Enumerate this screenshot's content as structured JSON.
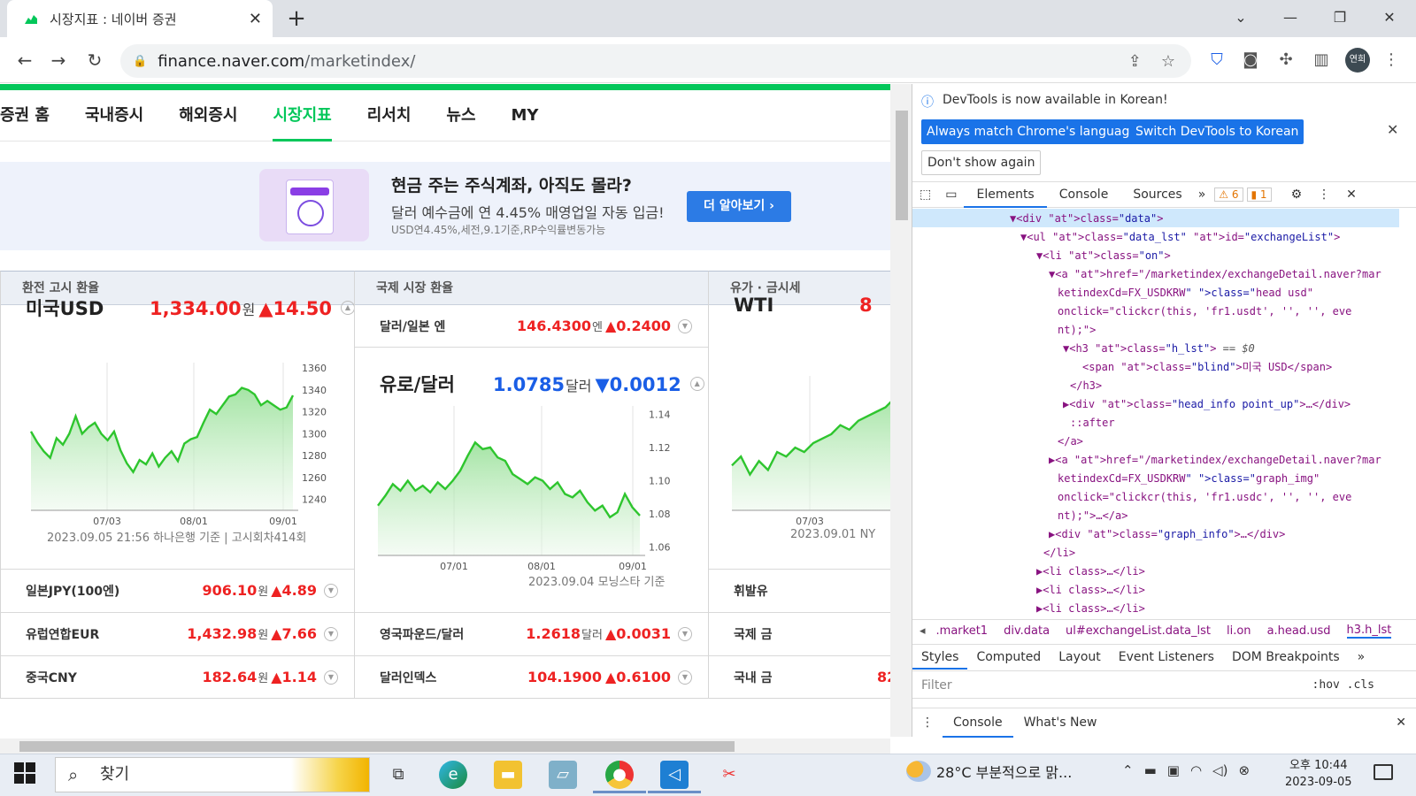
{
  "browser": {
    "tab_title": "시장지표 : 네이버 증권",
    "tab_close": "✕",
    "new_tab": "+",
    "url_host": "finance.naver.com",
    "url_path": "/marketindex/",
    "profile": "연희"
  },
  "naver": {
    "gnb": [
      {
        "label": "증권 홈",
        "on": false
      },
      {
        "label": "국내증시",
        "on": false
      },
      {
        "label": "해외증시",
        "on": false
      },
      {
        "label": "시장지표",
        "on": true
      },
      {
        "label": "리서치",
        "on": false
      },
      {
        "label": "뉴스",
        "on": false
      },
      {
        "label": "MY",
        "on": false
      }
    ],
    "banner": {
      "title": "현금 주는 주식계좌, 아직도 몰라?",
      "subtitle": "달러 예수금에 연 4.45% 매영업일 자동 입금!",
      "note": "USD연4.45%,세전,9.1기준,RP수익률변동가능",
      "button": "더 알아보기 ›"
    },
    "panels": {
      "exchange": {
        "heading": "환전 고시 환율",
        "main": {
          "name": "미국USD",
          "value": "1,334.00",
          "unit": "원",
          "change": "▲14.50"
        },
        "meta": "2023.09.05 21:56 하나은행 기준 | 고시회차414회",
        "rows": [
          {
            "name": "일본JPY(100엔)",
            "value": "906.10",
            "unit": "원",
            "change": "▲4.89"
          },
          {
            "name": "유럽연합EUR",
            "value": "1,432.98",
            "unit": "원",
            "change": "▲7.66"
          },
          {
            "name": "중국CNY",
            "value": "182.64",
            "unit": "원",
            "change": "▲1.14"
          }
        ]
      },
      "intl": {
        "heading": "국제 시장 환율",
        "top_row": {
          "name": "달러/일본 엔",
          "value": "146.4300",
          "unit": "엔",
          "change": "▲0.2400"
        },
        "main": {
          "name": "유로/달러",
          "value": "1.0785",
          "unit": "달러",
          "change": "▼0.0012"
        },
        "meta": "2023.09.04 모닝스타 기준",
        "rows": [
          {
            "name": "영국파운드/달러",
            "value": "1.2618",
            "unit": "달러",
            "change": "▲0.0031"
          },
          {
            "name": "달러인덱스",
            "value": "104.1900",
            "unit": "",
            "change": "▲0.6100"
          }
        ]
      },
      "oil": {
        "heading": "유가 · 금시세",
        "main": {
          "name": "WTI",
          "value": "8"
        },
        "meta": "2023.09.01 NY",
        "rows": [
          {
            "name": "휘발유",
            "value": ""
          },
          {
            "name": "국제 금",
            "value": ""
          },
          {
            "name": "국내 금",
            "value": "82"
          }
        ]
      }
    }
  },
  "chart_data": [
    {
      "type": "area",
      "x_ticks": [
        "07/03",
        "08/01",
        "09/01"
      ],
      "y_ticks": [
        1360,
        1340,
        1320,
        1300,
        1280,
        1260,
        1240
      ],
      "ylim": [
        1230,
        1365
      ],
      "values": [
        1302,
        1292,
        1284,
        1278,
        1296,
        1290,
        1300,
        1316,
        1300,
        1306,
        1310,
        1300,
        1294,
        1302,
        1285,
        1273,
        1265,
        1276,
        1272,
        1282,
        1270,
        1278,
        1284,
        1275,
        1291,
        1295,
        1297,
        1310,
        1322,
        1318,
        1326,
        1334,
        1336,
        1342,
        1340,
        1336,
        1326,
        1330,
        1326,
        1322,
        1324,
        1335
      ]
    },
    {
      "type": "area",
      "x_ticks": [
        "07/01",
        "08/01",
        "09/01"
      ],
      "y_ticks": [
        1.14,
        1.12,
        1.1,
        1.08,
        1.06
      ],
      "ylim": [
        1.055,
        1.145
      ],
      "values": [
        1.085,
        1.091,
        1.098,
        1.094,
        1.1,
        1.094,
        1.097,
        1.093,
        1.099,
        1.095,
        1.1,
        1.106,
        1.115,
        1.123,
        1.119,
        1.12,
        1.114,
        1.112,
        1.104,
        1.101,
        1.098,
        1.102,
        1.1,
        1.095,
        1.099,
        1.092,
        1.09,
        1.094,
        1.087,
        1.082,
        1.085,
        1.078,
        1.081,
        1.092,
        1.084,
        1.079
      ]
    },
    {
      "type": "area",
      "x_ticks": [
        "07/03"
      ],
      "y_ticks": [],
      "ylim": [
        60,
        90
      ],
      "values": [
        70,
        72,
        68,
        71,
        69,
        73,
        72,
        74,
        73,
        75,
        76,
        77,
        79,
        78,
        80,
        81,
        82,
        83,
        85,
        86
      ]
    }
  ],
  "devtools": {
    "info": "DevTools is now available in Korean!",
    "btn_match": "Always match Chrome's language",
    "btn_switch": "Switch DevTools to Korean",
    "btn_noshow": "Don't show again",
    "tabs": [
      "Elements",
      "Console",
      "Sources",
      "»"
    ],
    "warn_count": "6",
    "issue_count": "1",
    "crumbs": [
      ".market1",
      "div.data",
      "ul#exchangeList.data_lst",
      "li.on",
      "a.head.usd",
      "h3.h_lst"
    ],
    "style_tabs": [
      "Styles",
      "Computed",
      "Layout",
      "Event Listeners",
      "DOM Breakpoints",
      "»"
    ],
    "filter_placeholder": "Filter",
    "filter_right": ":hov  .cls",
    "drawer_tabs": [
      "Console",
      "What's New"
    ],
    "dom_lines": [
      "▼<div class=\"data\">",
      "▼<ul class=\"data_lst\" id=\"exchangeList\">",
      "▼<li class=\"on\">",
      "▼<a href=\"/marketindex/exchangeDetail.naver?mar",
      "ketindexCd=FX_USDKRW\" class=\"head usd\"",
      "onclick=\"clickcr(this, 'fr1.usdt', '', '', eve",
      "nt);\">",
      "▼<h3 class=\"h_lst\"> == $0",
      "<span class=\"blind\">미국 USD</span>",
      "</h3>",
      "▶<div class=\"head_info point_up\">…</div>",
      "::after",
      "</a>",
      "▶<a href=\"/marketindex/exchangeDetail.naver?mar",
      "ketindexCd=FX_USDKRW\" class=\"graph_img\"",
      "onclick=\"clickcr(this, 'fr1.usdc', '', '', eve",
      "nt);\">…</a>",
      "▶<div class=\"graph_info\">…</div>",
      "</li>",
      "▶<li class>…</li>",
      "▶<li class>…</li>",
      "▶<li class>…</li>"
    ]
  },
  "taskbar": {
    "search": "찾기",
    "weather": "28°C  부분적으로 맑...",
    "time": "오후 10:44",
    "date": "2023-09-05"
  }
}
